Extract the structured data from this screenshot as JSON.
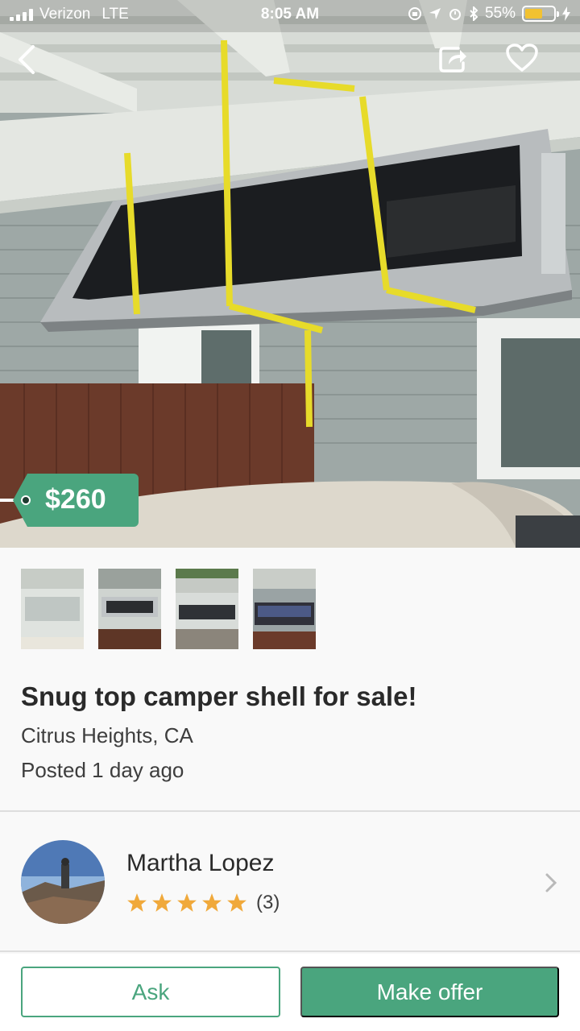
{
  "status_bar": {
    "carrier": "Verizon",
    "network": "LTE",
    "time": "8:05 AM",
    "battery": "55%",
    "battery_level": 0.55
  },
  "listing": {
    "price": "$260",
    "title": "Snug top camper shell for sale!",
    "location": "Citrus Heights, CA",
    "posted": "Posted 1 day ago",
    "photo_count": 4
  },
  "seller": {
    "name": "Martha Lopez",
    "rating_stars": 5,
    "rating_count": "(3)"
  },
  "actions": {
    "ask_label": "Ask",
    "offer_label": "Make offer"
  },
  "colors": {
    "accent": "#4aa57e",
    "star": "#f0a93b"
  },
  "icons": [
    "back-arrow-icon",
    "share-icon",
    "heart-icon",
    "chevron-right-icon",
    "star-icon"
  ]
}
